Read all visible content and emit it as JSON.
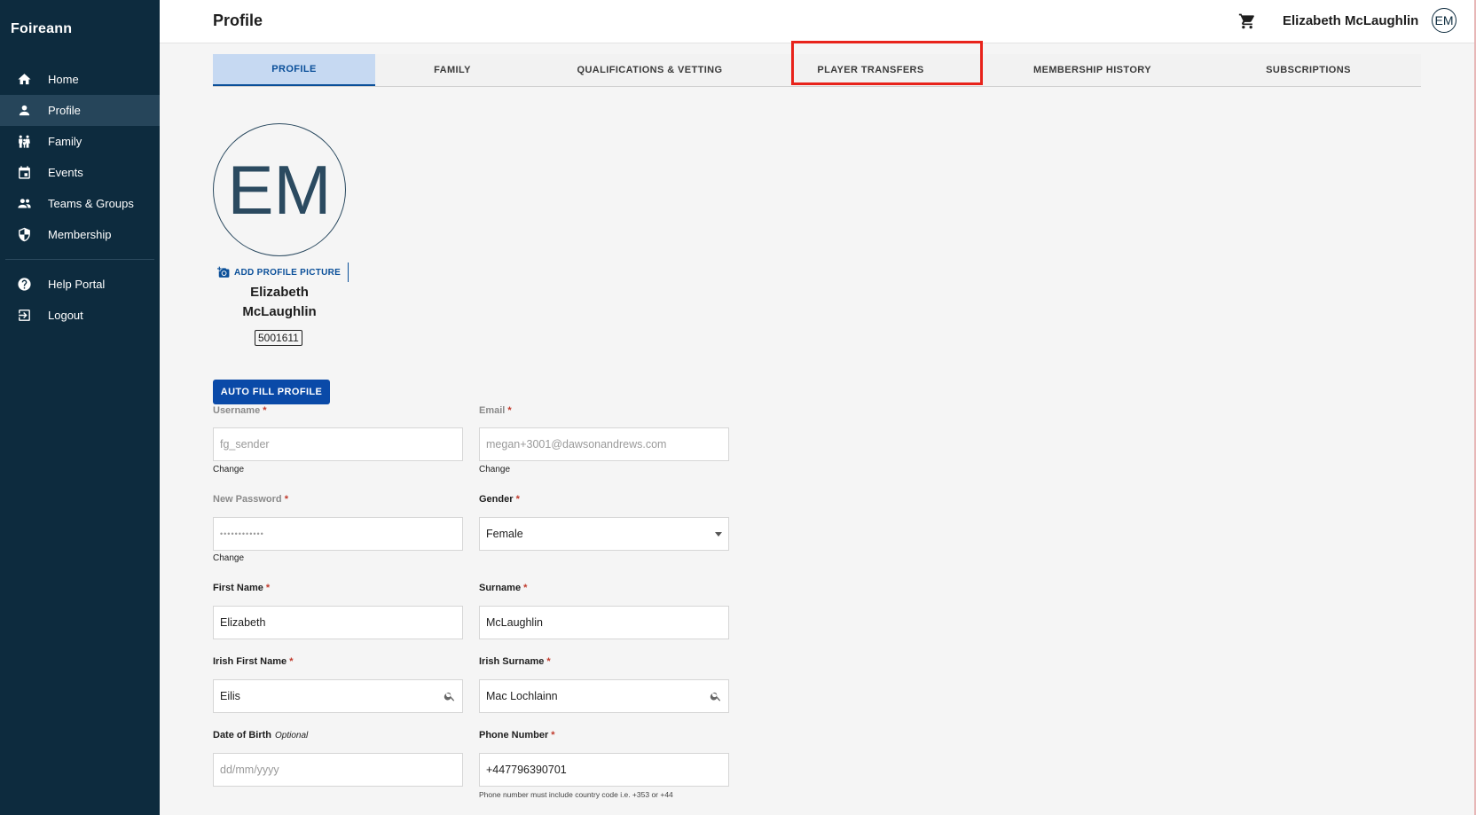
{
  "app": {
    "brand": "Foireann"
  },
  "sidebar": {
    "items": [
      {
        "label": "Home",
        "icon": "home-icon"
      },
      {
        "label": "Profile",
        "icon": "person-icon",
        "active": true
      },
      {
        "label": "Family",
        "icon": "family-icon"
      },
      {
        "label": "Events",
        "icon": "calendar-icon"
      },
      {
        "label": "Teams & Groups",
        "icon": "group-icon"
      },
      {
        "label": "Membership",
        "icon": "shield-icon"
      }
    ],
    "secondary": [
      {
        "label": "Help Portal",
        "icon": "help-icon"
      },
      {
        "label": "Logout",
        "icon": "logout-icon"
      }
    ]
  },
  "header": {
    "title": "Profile",
    "user_name": "Elizabeth McLaughlin",
    "user_initials": "EM"
  },
  "tabs": [
    {
      "label": "PROFILE",
      "active": true
    },
    {
      "label": "FAMILY"
    },
    {
      "label": "QUALIFICATIONS & VETTING"
    },
    {
      "label": "PLAYER TRANSFERS",
      "highlighted": true
    },
    {
      "label": "MEMBERSHIP HISTORY"
    },
    {
      "label": "SUBSCRIPTIONS"
    }
  ],
  "profile": {
    "initials": "EM",
    "add_picture_label": "ADD PROFILE PICTURE",
    "name_line1": "Elizabeth",
    "name_line2": "McLaughlin",
    "member_id": "5001611",
    "autofill_label": "AUTO FILL PROFILE"
  },
  "form": {
    "username": {
      "label": "Username",
      "required": "*",
      "value": "fg_sender",
      "change": "Change"
    },
    "email": {
      "label": "Email",
      "required": "*",
      "value": "megan+3001@dawsonandrews.com",
      "change": "Change"
    },
    "password": {
      "label": "New Password",
      "required": "*",
      "value": "••••••••••••",
      "change": "Change"
    },
    "gender": {
      "label": "Gender",
      "required": "*",
      "value": "Female"
    },
    "first_name": {
      "label": "First Name",
      "required": "*",
      "value": "Elizabeth"
    },
    "surname": {
      "label": "Surname",
      "required": "*",
      "value": "McLaughlin"
    },
    "irish_first_name": {
      "label": "Irish First Name",
      "required": "*",
      "value": "Eilis"
    },
    "irish_surname": {
      "label": "Irish Surname",
      "required": "*",
      "value": "Mac Lochlainn"
    },
    "dob": {
      "label": "Date of Birth",
      "optional": "Optional",
      "placeholder": "dd/mm/yyyy"
    },
    "phone": {
      "label": "Phone Number",
      "required": "*",
      "value": "+447796390701",
      "helper": "Phone number must include country code i.e. +353 or +44"
    }
  },
  "colors": {
    "sidebar_bg": "#0d2b3e",
    "sidebar_active": "#26455a",
    "accent": "#0a4aa8",
    "tab_active_bg": "#c6d9f2",
    "highlight_box": "#e8231b",
    "required": "#c0392b"
  }
}
